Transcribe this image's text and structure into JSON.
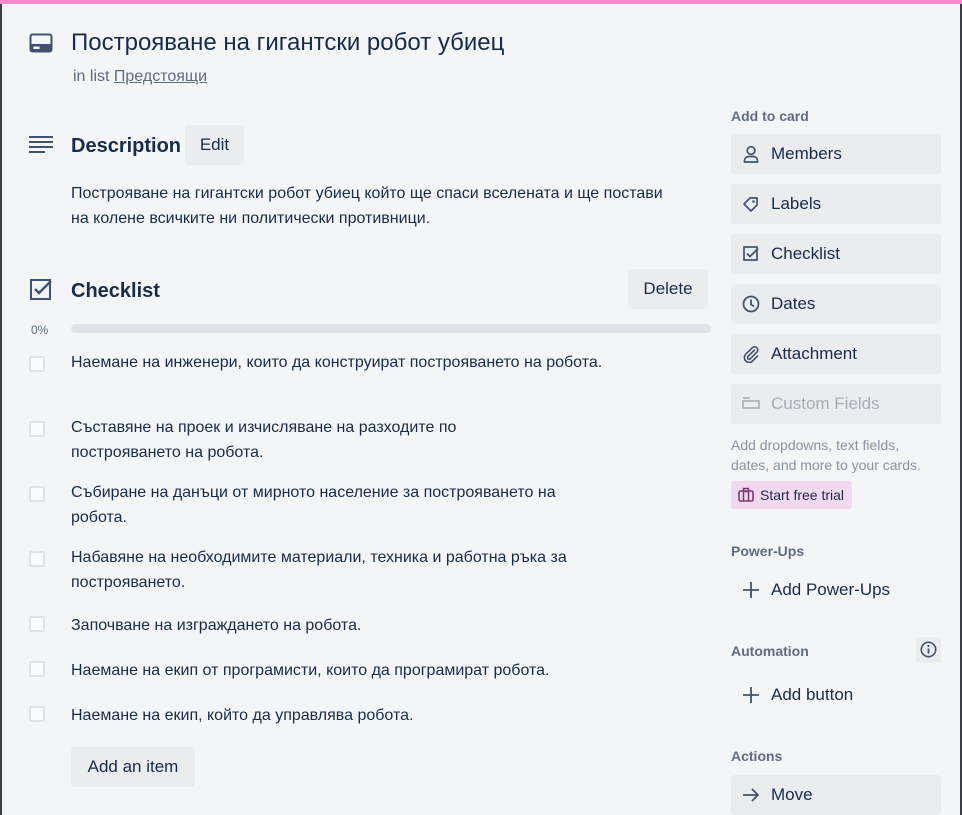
{
  "card": {
    "title": "Построяване на гигантски робот убиец",
    "in_list_prefix": "in list",
    "list_name": "Предстоящи"
  },
  "description": {
    "heading": "Description",
    "edit_label": "Edit",
    "text": "Построяване на гигантски робот убиец който ще спаси вселената и ще постави на колене всичките ни политически противници."
  },
  "checklist": {
    "heading": "Checklist",
    "delete_label": "Delete",
    "progress_label": "0%",
    "progress_fraction": 0,
    "items": [
      {
        "text": "Наемане на инженери, които да конструират построяването на робота.",
        "checked": false
      },
      {
        "text": "Съставяне на проек и изчисляване на разходите по построяването на робота.",
        "checked": false
      },
      {
        "text": "Събиране на данъци от мирното население за построяването на робота.",
        "checked": false
      },
      {
        "text": "Набавяне на необходимите материали, техника и работна ръка за построяването.",
        "checked": false
      },
      {
        "text": "Започване на изграждането на робота.",
        "checked": false
      },
      {
        "text": "Наемане на екип от програмисти, които да програмират робота.",
        "checked": false
      },
      {
        "text": "Наемане на екип, който да управлява робота.",
        "checked": false
      }
    ],
    "add_item_label": "Add an item"
  },
  "sidebar": {
    "add_to_card_heading": "Add to card",
    "add_to_card": [
      {
        "label": "Members",
        "icon": "person-icon"
      },
      {
        "label": "Labels",
        "icon": "tag-icon"
      },
      {
        "label": "Checklist",
        "icon": "checkbox-icon"
      },
      {
        "label": "Dates",
        "icon": "clock-icon"
      },
      {
        "label": "Attachment",
        "icon": "paperclip-icon"
      },
      {
        "label": "Custom Fields",
        "icon": "custom-fields-icon",
        "disabled": true
      }
    ],
    "custom_fields_note": "Add dropdowns, text fields, dates, and more to your cards.",
    "trial_label": "Start free trial",
    "powerups_heading": "Power-Ups",
    "add_powerups_label": "Add Power-Ups",
    "automation_heading": "Automation",
    "add_button_label": "Add button",
    "actions_heading": "Actions",
    "move_label": "Move"
  },
  "colors": {
    "top_accent": "#f28cd2",
    "background": "#f4f5f7",
    "button_bg": "#ebecf0",
    "trial_bg": "#f2d9f0",
    "text": "#172b4d",
    "muted": "#5e6c84"
  }
}
